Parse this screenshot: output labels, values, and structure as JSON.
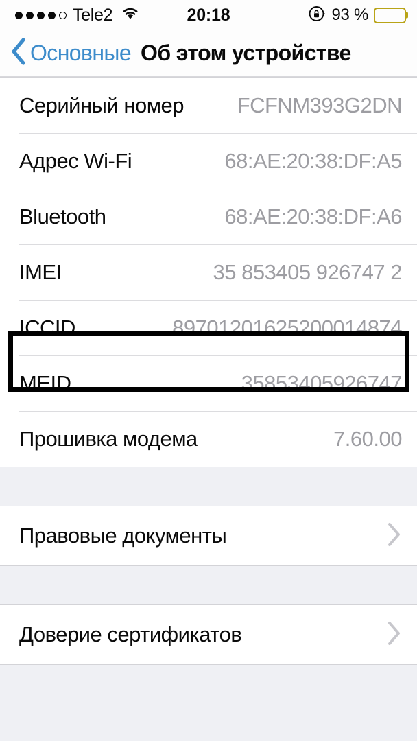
{
  "status_bar": {
    "carrier": "Tele2",
    "signal_dots_filled": 4,
    "signal_dots_total": 5,
    "wifi_icon": "wifi-icon",
    "time": "20:18",
    "rotation_lock_icon": "rotation-lock-icon",
    "battery_percent": "93 %",
    "battery_level": 93,
    "battery_color": "#ffd60a"
  },
  "nav": {
    "back_icon": "chevron-left-icon",
    "back_label": "Основные",
    "title": "Об этом устройстве",
    "accent_color": "#3d8ccb"
  },
  "sections": [
    {
      "rows": [
        {
          "label": "Серийный номер",
          "value": "FCFNM393G2DN"
        },
        {
          "label": "Адрес Wi-Fi",
          "value": "68:AE:20:38:DF:A5"
        },
        {
          "label": "Bluetooth",
          "value": "68:AE:20:38:DF:A6"
        },
        {
          "label": "IMEI",
          "value": "35 853405 926747 2",
          "highlighted": true
        },
        {
          "label": "ICCID",
          "value": "89701201625200014874"
        },
        {
          "label": "MEID",
          "value": "35853405926747"
        },
        {
          "label": "Прошивка модема",
          "value": "7.60.00"
        }
      ]
    },
    {
      "rows": [
        {
          "label": "Правовые документы",
          "value": "",
          "chevron": "chevron-right-icon"
        }
      ]
    },
    {
      "rows": [
        {
          "label": "Доверие сертификатов",
          "value": "",
          "chevron": "chevron-right-icon"
        }
      ]
    }
  ],
  "annotation": {
    "target_row": "IMEI",
    "box_color": "#000000"
  }
}
